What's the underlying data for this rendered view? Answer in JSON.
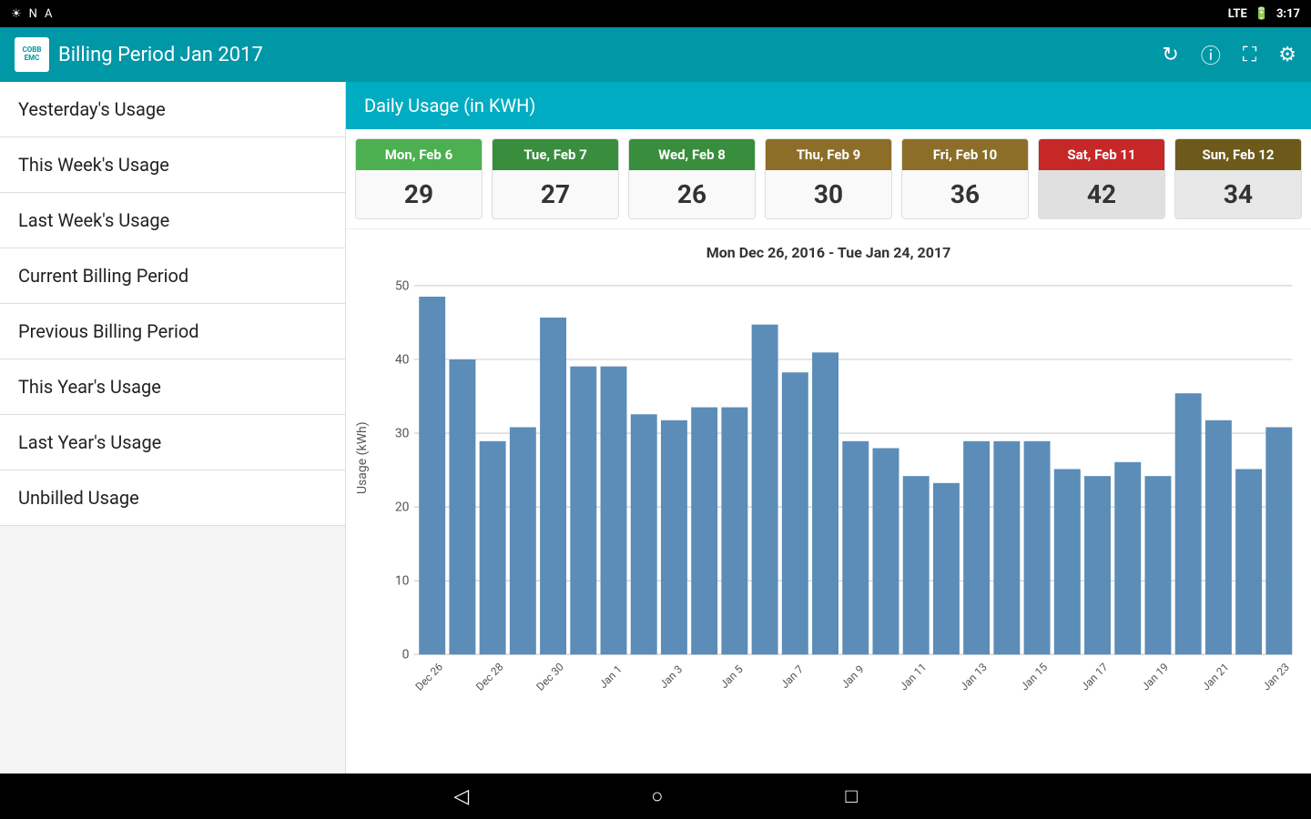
{
  "statusBar": {
    "time": "3:17",
    "icons_left": [
      "wifi-icon",
      "notification-icon",
      "app-icon"
    ],
    "icons_right": [
      "lte-icon",
      "battery-icon"
    ]
  },
  "appBar": {
    "logo_line1": "COBB",
    "logo_line2": "EMC",
    "title": "Billing Period Jan 2017",
    "actions": [
      "refresh-icon",
      "info-icon",
      "fullscreen-icon",
      "settings-icon"
    ]
  },
  "sidebar": {
    "items": [
      {
        "label": "Yesterday's Usage"
      },
      {
        "label": "This Week's Usage"
      },
      {
        "label": "Last Week's Usage"
      },
      {
        "label": "Current Billing Period"
      },
      {
        "label": "Previous Billing Period"
      },
      {
        "label": "This Year's Usage"
      },
      {
        "label": "Last Year's Usage"
      },
      {
        "label": "Unbilled Usage"
      }
    ]
  },
  "dailyUsage": {
    "sectionTitle": "Daily Usage (in KWH)",
    "days": [
      {
        "label": "Mon, Feb 6",
        "value": "29",
        "colorClass": "green"
      },
      {
        "label": "Tue, Feb 7",
        "value": "27",
        "colorClass": "dark-green"
      },
      {
        "label": "Wed, Feb 8",
        "value": "26",
        "colorClass": "dark-green"
      },
      {
        "label": "Thu, Feb 9",
        "value": "30",
        "colorClass": "olive"
      },
      {
        "label": "Fri, Feb 10",
        "value": "36",
        "colorClass": "olive"
      },
      {
        "label": "Sat, Feb 11",
        "value": "42",
        "colorClass": "red",
        "special": "saturday"
      },
      {
        "label": "Sun, Feb 12",
        "value": "34",
        "colorClass": "dark-olive",
        "special": "sunday"
      }
    ]
  },
  "chart": {
    "dateRange": "Mon Dec 26, 2016 - Tue Jan 24, 2017",
    "yAxisLabel": "Usage (kWh)",
    "xAxisLabels": [
      "Dec 26",
      "Dec 28",
      "Dec 30",
      "Jan 1",
      "Jan 3",
      "Jan 5",
      "Jan 7",
      "Jan 9",
      "Jan 11",
      "Jan 13",
      "Jan 15",
      "Jan 17",
      "Jan 19",
      "Jan 21",
      "Jan 23"
    ],
    "yAxisValues": [
      0,
      10,
      20,
      30,
      40,
      50
    ],
    "bars": [
      52,
      43,
      31,
      33,
      49,
      42,
      42,
      35,
      34,
      36,
      36,
      48,
      41,
      44,
      31,
      30,
      26,
      25,
      31,
      31,
      31,
      27,
      26,
      28,
      26,
      38,
      34,
      27,
      33
    ]
  },
  "bottomNav": {
    "back": "◁",
    "home": "○",
    "recent": "□"
  }
}
